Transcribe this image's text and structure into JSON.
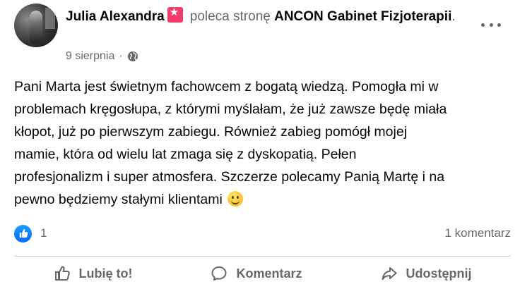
{
  "post": {
    "author": "Julia Alexandra",
    "action": "poleca stronę",
    "page": "ANCON Gabinet Fizjoterapii",
    "trailing": ".",
    "date": "9 sierpnia",
    "separator": "·",
    "privacy_icon": "globe-icon",
    "badge_icon": "recommend-star-icon",
    "text": "Pani Marta jest świetnym fachowcem z bogatą wiedzą. Pomogła mi w\nproblemach kręgosłupa, z którymi myślałam, że już zawsze będę miała\nkłopot, już po pierwszym zabiegu. Również zabieg pomógł mojej\nmamie, która od wielu lat zmaga się z dyskopatią. Pełen\nprofesjonalizm i super atmosfera. Szczerze polecamy Panią Martę i na\npewno będziemy stałymi klientami",
    "emoji": "smiley-emoji"
  },
  "stats": {
    "likes": "1",
    "comments": "1 komentarz"
  },
  "actions": {
    "like": "Lubię to!",
    "comment": "Komentarz",
    "share": "Udostępnij"
  },
  "colors": {
    "secondary_text": "#65676b",
    "primary_text": "#050505",
    "like_blue": "#0866ff",
    "badge_pink": "#f23b6b",
    "divider": "#ced0d4"
  }
}
